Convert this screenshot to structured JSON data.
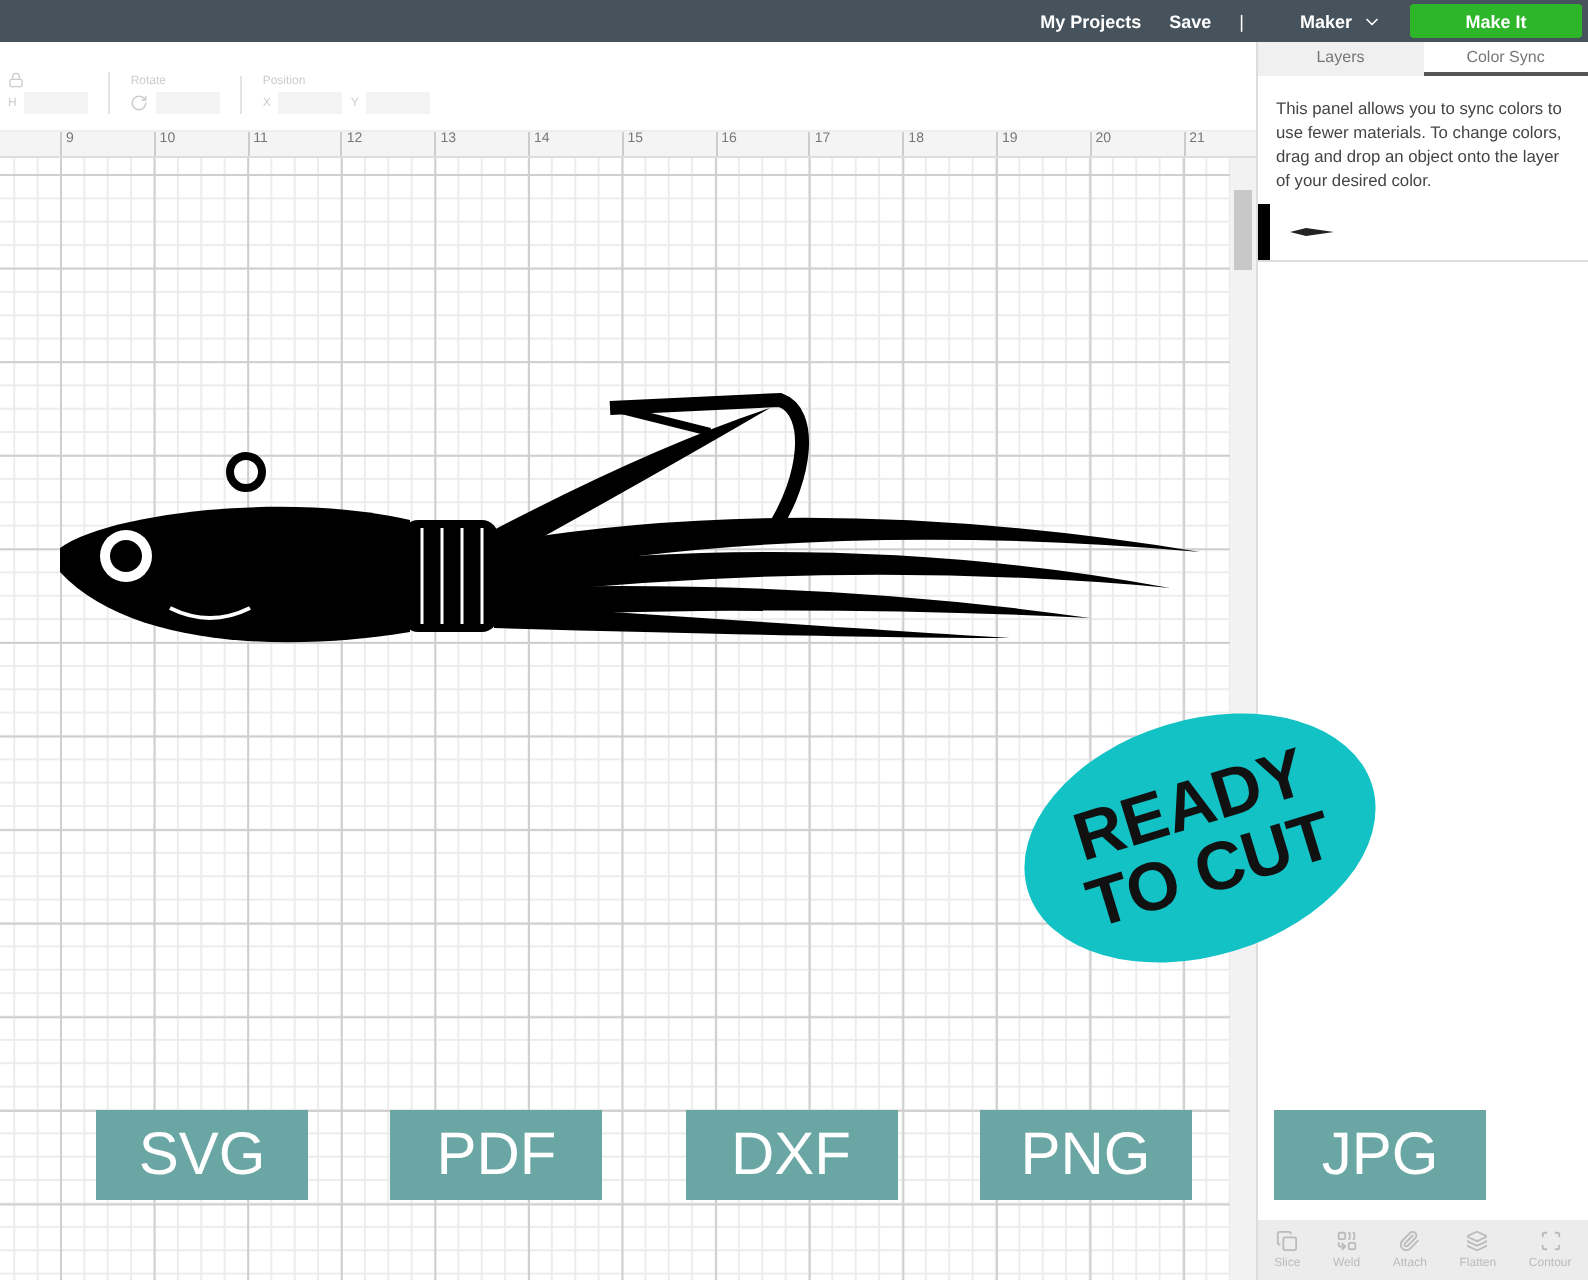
{
  "top_bar": {
    "links": [
      "My Projects",
      "Save"
    ],
    "separator": "|",
    "machine": "Maker",
    "make_button": "Make It"
  },
  "toolbar": {
    "size_label": "H",
    "rotate_label": "Rotate",
    "position_label": "Position",
    "x_label": "X",
    "y_label": "Y"
  },
  "ruler": [
    "9",
    "10",
    "11",
    "12",
    "13",
    "14",
    "15",
    "16",
    "17",
    "18",
    "19",
    "20",
    "21"
  ],
  "panel": {
    "tabs": [
      {
        "label": "Layers",
        "selected": false
      },
      {
        "label": "Color Sync",
        "selected": true
      }
    ],
    "description": "This panel allows you to sync colors to use fewer materials. To change colors, drag and drop an object onto the layer of your desired color.",
    "layers": [
      {
        "color": "#000000"
      }
    ]
  },
  "actions": [
    "Slice",
    "Weld",
    "Attach",
    "Flatten",
    "Contour"
  ],
  "promo": {
    "badge": [
      "READY",
      "TO CUT"
    ],
    "formats": [
      "SVG",
      "PDF",
      "DXF",
      "PNG",
      "JPG"
    ]
  }
}
